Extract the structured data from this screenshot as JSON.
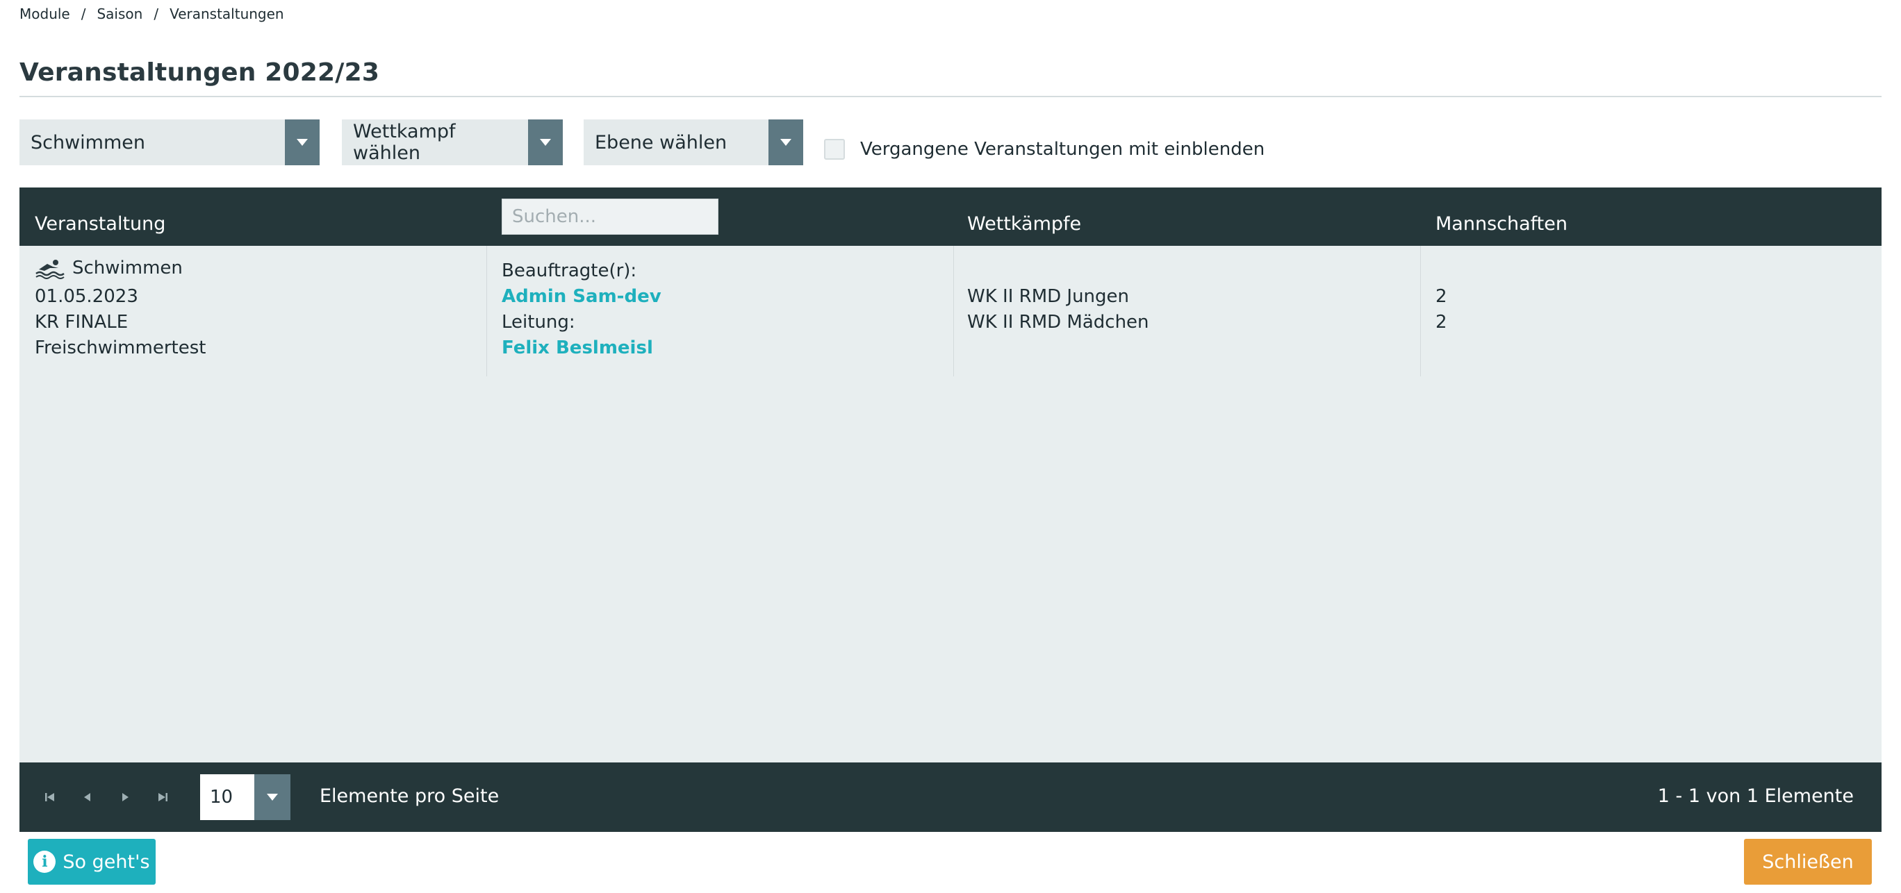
{
  "breadcrumb": {
    "items": [
      "Module",
      "Saison",
      "Veranstaltungen"
    ],
    "separator": "/"
  },
  "page": {
    "title": "Veranstaltungen 2022/23"
  },
  "filters": {
    "sport": {
      "value": "Schwimmen"
    },
    "competition": {
      "value": "Wettkampf wählen"
    },
    "level": {
      "value": "Ebene wählen"
    },
    "show_past": {
      "label": "Vergangene Veranstaltungen mit einblenden",
      "checked": false
    }
  },
  "grid": {
    "columns": {
      "event": "Veranstaltung",
      "search_placeholder": "Suchen...",
      "competitions": "Wettkämpfe",
      "teams": "Mannschaften"
    },
    "rows": [
      {
        "sport": "Schwimmen",
        "sport_icon": "swimmer-icon",
        "date": "01.05.2023",
        "round": "KR FINALE",
        "name": "Freischwimmertest",
        "commissioner_label": "Beauftragte(r):",
        "commissioner": "Admin Sam-dev",
        "lead_label": "Leitung:",
        "lead": "Felix Beslmeisl",
        "competitions": [
          "WK II RMD Jungen",
          "WK II RMD Mädchen"
        ],
        "teams": [
          "2",
          "2"
        ]
      }
    ]
  },
  "pager": {
    "page_size": "10",
    "per_page_label": "Elemente pro Seite",
    "count_text": "1 - 1 von 1 Elemente"
  },
  "buttons": {
    "help": "So geht's",
    "close": "Schließen"
  },
  "colors": {
    "header_bg": "#25373a",
    "accent_teal": "#1eb0bd",
    "close_orange": "#e99d38",
    "select_arrow": "#5d7882",
    "grid_bg": "#e8eeef"
  }
}
